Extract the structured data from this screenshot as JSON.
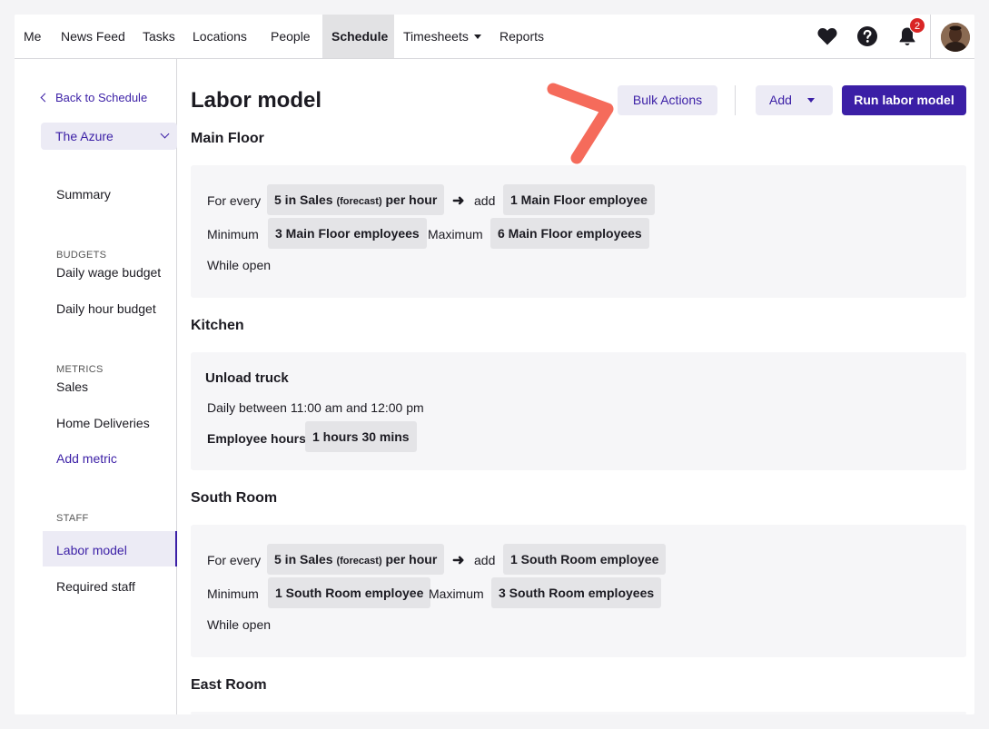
{
  "nav": {
    "items": [
      "Me",
      "News Feed",
      "Tasks",
      "Locations",
      "People",
      "Schedule",
      "Timesheets",
      "Reports"
    ],
    "active": "Schedule",
    "notification_count": "2",
    "icons": [
      "heart-icon",
      "help-icon",
      "bell-icon"
    ]
  },
  "sidebar": {
    "back_label": "Back to Schedule",
    "location": "The Azure",
    "summary": "Summary",
    "budgets_heading": "BUDGETS",
    "daily_wage_budget": "Daily wage budget",
    "daily_hour_budget": "Daily hour budget",
    "metrics_heading": "METRICS",
    "sales": "Sales",
    "home_deliveries": "Home Deliveries",
    "add_metric": "Add metric",
    "staff_heading": "STAFF",
    "labor_model": "Labor model",
    "required_staff": "Required staff"
  },
  "main": {
    "title": "Labor model",
    "bulk_actions": "Bulk Actions",
    "add": "Add",
    "run_labor_model": "Run labor model",
    "sections": {
      "main_floor": {
        "title": "Main Floor",
        "for_every": "For every",
        "rate_prefix": "5 in Sales",
        "rate_forecast": "(forecast)",
        "rate_suffix": "per hour",
        "add": "add",
        "add_value": "1 Main Floor employee",
        "minimum": "Minimum",
        "minimum_value": "3 Main Floor employees",
        "maximum": "Maximum",
        "maximum_value": "6 Main Floor employees",
        "while_open": "While open"
      },
      "kitchen": {
        "title": "Kitchen",
        "task": "Unload truck",
        "schedule": "Daily between 11:00 am and 12:00 pm",
        "employee_hours": "Employee hours",
        "employee_hours_value": "1 hours 30 mins"
      },
      "south_room": {
        "title": "South Room",
        "for_every": "For every",
        "rate_prefix": "5 in Sales",
        "rate_forecast": "(forecast)",
        "rate_suffix": "per hour",
        "add": "add",
        "add_value": "1 South Room employee",
        "minimum": "Minimum",
        "minimum_value": "1 South Room employee",
        "maximum": "Maximum",
        "maximum_value": "3 South Room employees",
        "while_open": "While open"
      },
      "east_room": {
        "title": "East Room"
      }
    }
  },
  "colors": {
    "accent": "#3b1fa6",
    "annotation": "#f56b5b",
    "badge": "#d92525"
  }
}
